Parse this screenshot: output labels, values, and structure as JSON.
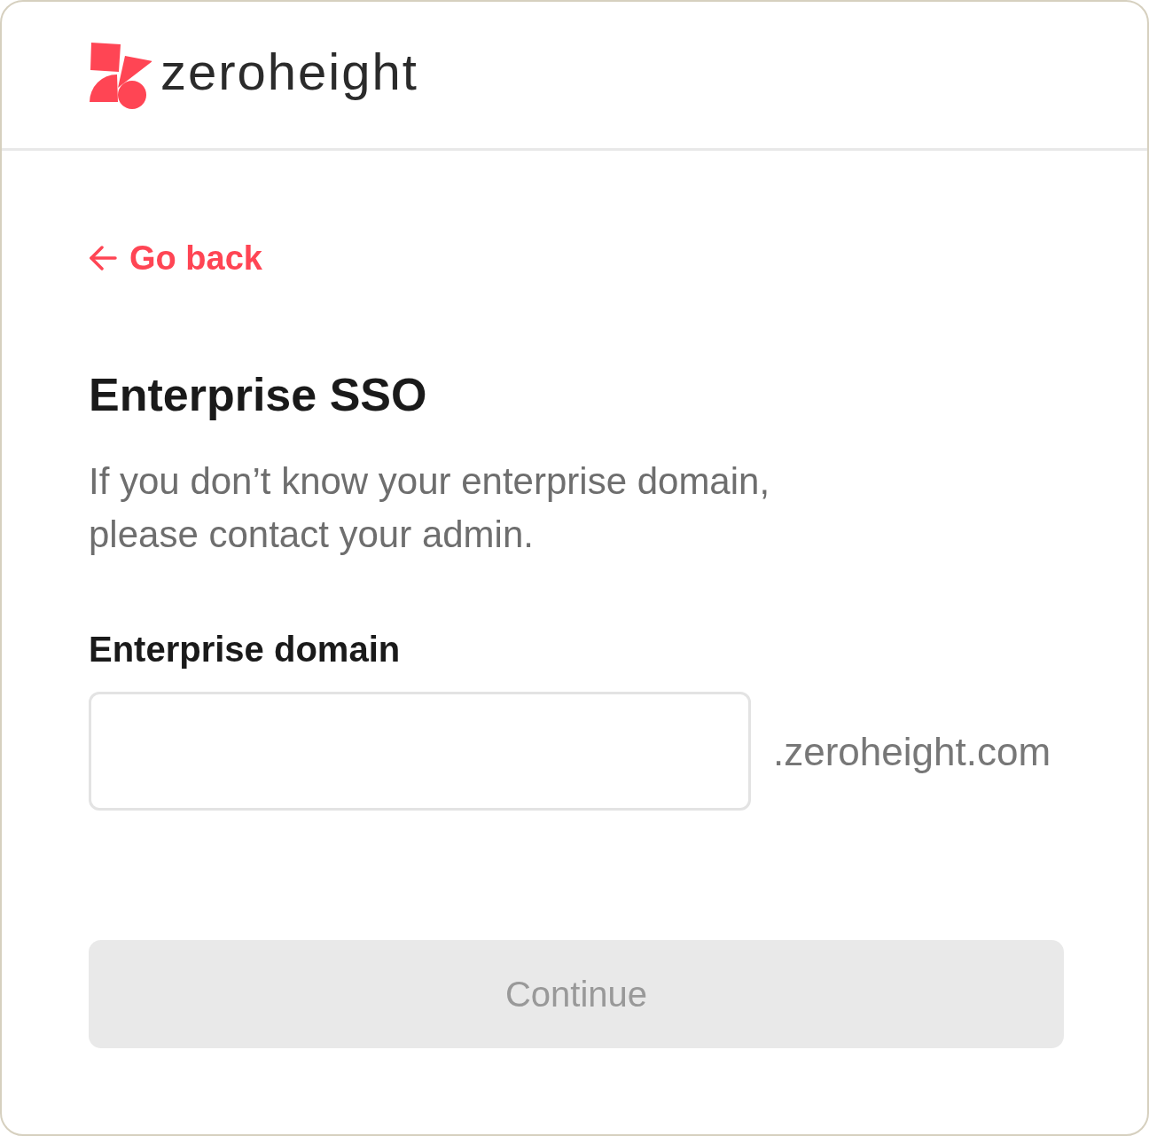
{
  "header": {
    "logo_text": "zeroheight"
  },
  "back_link": {
    "label": "Go back"
  },
  "title": "Enterprise SSO",
  "description": "If you don’t know your enterprise domain, please contact your admin.",
  "domain_field": {
    "label": "Enterprise domain",
    "suffix": ".zeroheight.com"
  },
  "continue_button": {
    "label": "Continue",
    "disabled": true
  }
}
